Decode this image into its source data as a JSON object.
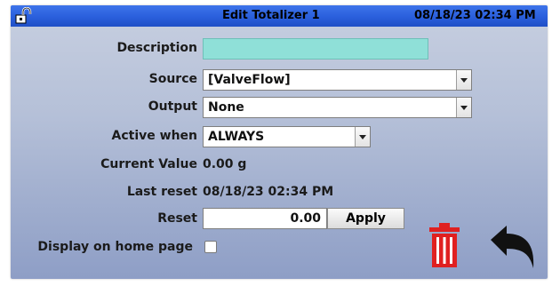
{
  "header": {
    "title": "Edit Totalizer 1",
    "datetime": "08/18/23 02:34 PM"
  },
  "form": {
    "description": {
      "label": "Description",
      "value": ""
    },
    "source": {
      "label": "Source",
      "value": "[ValveFlow]"
    },
    "output": {
      "label": "Output",
      "value": "None"
    },
    "active_when": {
      "label": "Active when",
      "value": "ALWAYS"
    },
    "current_value": {
      "label": "Current Value",
      "value": "0.00 g"
    },
    "last_reset": {
      "label": "Last reset",
      "value": "08/18/23 02:34 PM"
    },
    "reset": {
      "label": "Reset",
      "value": "0.00",
      "button": "Apply"
    },
    "display_home": {
      "label": "Display on home page",
      "checked": false
    }
  },
  "colors": {
    "titlebar": "#2a5fdc",
    "description_fill": "#8fe0d8",
    "trash": "#e02020"
  },
  "icons": {
    "lock": "unlock-icon",
    "trash": "trash-icon",
    "back": "back-arrow-icon"
  }
}
